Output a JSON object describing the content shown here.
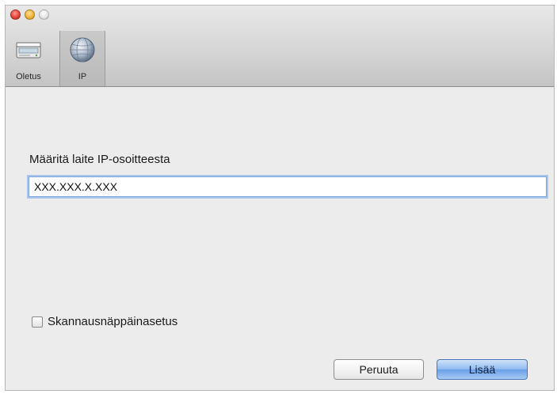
{
  "window": {
    "title": ""
  },
  "toolbar": {
    "items": [
      {
        "id": "oletus",
        "label": "Oletus",
        "icon": "scanner-icon",
        "selected": false
      },
      {
        "id": "ip",
        "label": "IP",
        "icon": "network-globe-icon",
        "selected": true
      }
    ]
  },
  "form": {
    "ip_label": "Määritä laite IP-osoitteesta",
    "ip_value": "XXX.XXX.X.XXX",
    "scan_key_label": "Skannausnäppäinasetus",
    "scan_key_checked": false
  },
  "buttons": {
    "cancel_label": "Peruuta",
    "add_label": "Lisää"
  },
  "colors": {
    "window_bg": "#ececec",
    "default_button": "#8fbaf0",
    "focus_ring": "#a9c6ec"
  }
}
